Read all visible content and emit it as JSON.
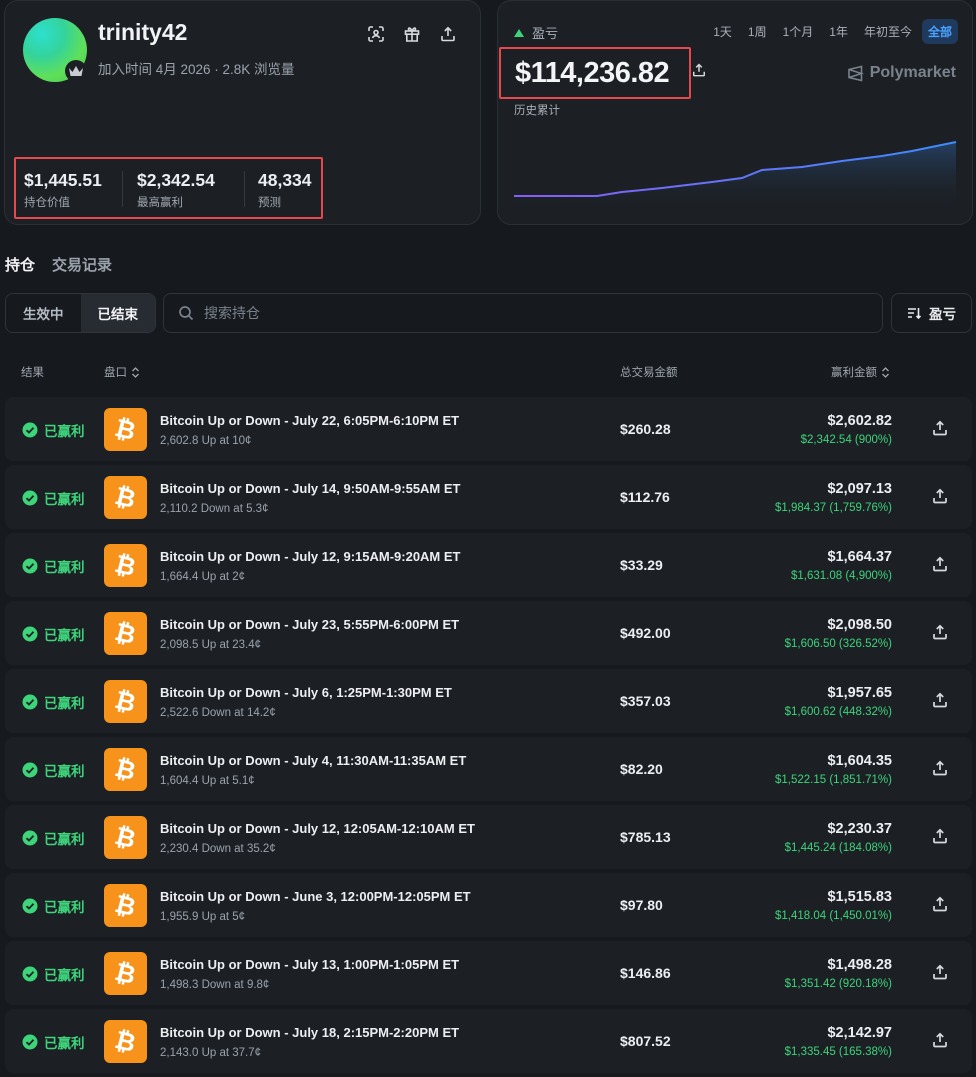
{
  "profile": {
    "username": "trinity42",
    "joined": "加入时间 4月 2026 · 2.8K 浏览量",
    "stats": [
      {
        "value": "$1,445.51",
        "label": "持仓价值"
      },
      {
        "value": "$2,342.54",
        "label": "最高赢利"
      },
      {
        "value": "48,334",
        "label": "预测"
      }
    ]
  },
  "pnl": {
    "label": "盈亏",
    "amount": "$114,236.82",
    "history_label": "历史累计",
    "brand": "Polymarket",
    "ranges": [
      "1天",
      "1周",
      "1个月",
      "1年",
      "年初至今",
      "全部"
    ],
    "active_range": "全部",
    "colors": {
      "line_start": "#8b5cf6",
      "line_end": "#3b8cff",
      "positive": "#3dd47a"
    }
  },
  "tabs": [
    "持仓",
    "交易记录"
  ],
  "filters": {
    "segments": [
      "生效中",
      "已结束"
    ],
    "active_segment": "已结束",
    "search_placeholder": "搜索持仓",
    "sort_label": "盈亏"
  },
  "table": {
    "headers": {
      "result": "结果",
      "market": "盘口",
      "total": "总交易金额",
      "won": "赢利金额"
    },
    "rows": [
      {
        "result": "已赢利",
        "title": "Bitcoin Up or Down - July 22, 6:05PM-6:10PM ET",
        "sub": "2,602.8 Up at 10¢",
        "total": "$260.28",
        "won": "$2,602.82",
        "gain": "$2,342.54 (900%)"
      },
      {
        "result": "已赢利",
        "title": "Bitcoin Up or Down - July 14, 9:50AM-9:55AM ET",
        "sub": "2,110.2 Down at 5.3¢",
        "total": "$112.76",
        "won": "$2,097.13",
        "gain": "$1,984.37 (1,759.76%)"
      },
      {
        "result": "已赢利",
        "title": "Bitcoin Up or Down - July 12, 9:15AM-9:20AM ET",
        "sub": "1,664.4 Up at 2¢",
        "total": "$33.29",
        "won": "$1,664.37",
        "gain": "$1,631.08 (4,900%)"
      },
      {
        "result": "已赢利",
        "title": "Bitcoin Up or Down - July 23, 5:55PM-6:00PM ET",
        "sub": "2,098.5 Up at 23.4¢",
        "total": "$492.00",
        "won": "$2,098.50",
        "gain": "$1,606.50 (326.52%)"
      },
      {
        "result": "已赢利",
        "title": "Bitcoin Up or Down - July 6, 1:25PM-1:30PM ET",
        "sub": "2,522.6 Down at 14.2¢",
        "total": "$357.03",
        "won": "$1,957.65",
        "gain": "$1,600.62 (448.32%)"
      },
      {
        "result": "已赢利",
        "title": "Bitcoin Up or Down - July 4, 11:30AM-11:35AM ET",
        "sub": "1,604.4 Up at 5.1¢",
        "total": "$82.20",
        "won": "$1,604.35",
        "gain": "$1,522.15 (1,851.71%)"
      },
      {
        "result": "已赢利",
        "title": "Bitcoin Up or Down - July 12, 12:05AM-12:10AM ET",
        "sub": "2,230.4 Down at 35.2¢",
        "total": "$785.13",
        "won": "$2,230.37",
        "gain": "$1,445.24 (184.08%)"
      },
      {
        "result": "已赢利",
        "title": "Bitcoin Up or Down - June 3, 12:00PM-12:05PM ET",
        "sub": "1,955.9 Up at 5¢",
        "total": "$97.80",
        "won": "$1,515.83",
        "gain": "$1,418.04 (1,450.01%)"
      },
      {
        "result": "已赢利",
        "title": "Bitcoin Up or Down - July 13, 1:00PM-1:05PM ET",
        "sub": "1,498.3 Down at 9.8¢",
        "total": "$146.86",
        "won": "$1,498.28",
        "gain": "$1,351.42 (920.18%)"
      },
      {
        "result": "已赢利",
        "title": "Bitcoin Up or Down - July 18, 2:15PM-2:20PM ET",
        "sub": "2,143.0 Up at 37.7¢",
        "total": "$807.52",
        "won": "$2,142.97",
        "gain": "$1,335.45 (165.38%)"
      }
    ]
  },
  "icons": {
    "scan": "scan-icon",
    "gift": "gift-icon",
    "share": "share-icon",
    "crown": "crown-icon",
    "search": "search-icon",
    "sort": "sort-icon",
    "check": "check-circle-icon",
    "bitcoin": "bitcoin-icon",
    "logo": "polymarket-logo-icon"
  }
}
